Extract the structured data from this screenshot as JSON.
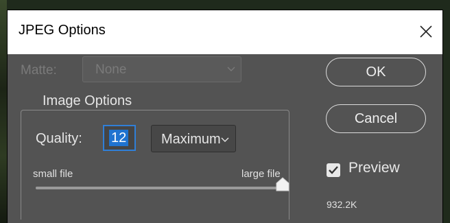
{
  "window": {
    "title": "JPEG Options"
  },
  "matte": {
    "label": "Matte:",
    "value": "None",
    "enabled": false
  },
  "image_options": {
    "title": "Image Options",
    "quality_label": "Quality:",
    "quality_value": "12",
    "quality_preset": "Maximum",
    "slider": {
      "min_label": "small file",
      "max_label": "large file",
      "value": 12,
      "min": 0,
      "max": 12
    }
  },
  "buttons": {
    "ok": "OK",
    "cancel": "Cancel"
  },
  "preview": {
    "label": "Preview",
    "checked": true
  },
  "file_size": "932.2K",
  "colors": {
    "dialog_bg": "#535353",
    "titlebar_bg": "#ffffff",
    "accent": "#1f73d0",
    "text": "#e6e6e6",
    "disabled_text": "#7a7a7a"
  },
  "icons": {
    "close": "close-icon",
    "dropdown": "chevron-down-icon",
    "checkbox": "checkmark-icon",
    "slider_thumb": "slider-thumb-icon"
  }
}
